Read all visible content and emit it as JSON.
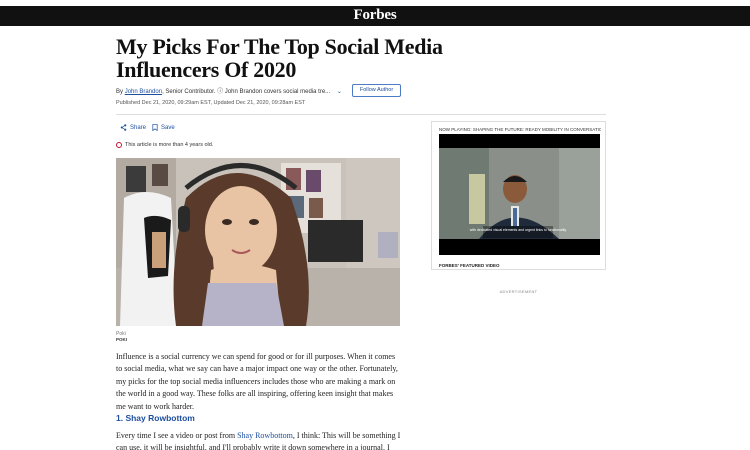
{
  "header": {
    "logo": "Forbes"
  },
  "article": {
    "title": "My Picks For The Top Social Media Influencers Of 2020",
    "byline": {
      "by": "By",
      "author": "John Brandon",
      "role": ", Senior Contributor.",
      "bio": "John Brandon covers social media tre...",
      "follow_label": "Follow Author"
    },
    "published": "Published Dec 21, 2020, 09:29am EST, Updated Dec 21, 2020, 09:28am EST",
    "share_label": "Share",
    "save_label": "Save",
    "old_notice": "This article is more than 4 years old.",
    "photo_caption": "Poki",
    "photo_credit": "POKI",
    "paragraph1": "Influence is a social currency we can spend for good or for ill purposes. When it comes to social media, what we say can have a major impact one way or the other. Fortunately, my picks for the top social media influencers includes those who are making a mark on the world in a good way. These folks are all inspiring, offering keen insight that makes me want to work harder.",
    "subhead": "1. Shay Rowbottom",
    "paragraph2_pre": "Every time I see a video or post from ",
    "paragraph2_link": "Shay Rowbottom",
    "paragraph2_post": ", I think: This will be something I can use, it will be insightful, and I'll probably write it down somewhere in a journal. I have noticed"
  },
  "sidebar": {
    "now_playing": "NOW PLAYING: SHAPING THE FUTURE: READY MOBILITY IN CONVERSATION WITH E...",
    "video_subtitle": "with dedicated visual elements and urgent links to functionality",
    "featured_label": "FORBES' FEATURED VIDEO",
    "advertisement": "ADVERTISEMENT"
  },
  "colors": {
    "link": "#1d4fa0",
    "topbar": "#111111",
    "notice_icon": "#c8102e"
  }
}
